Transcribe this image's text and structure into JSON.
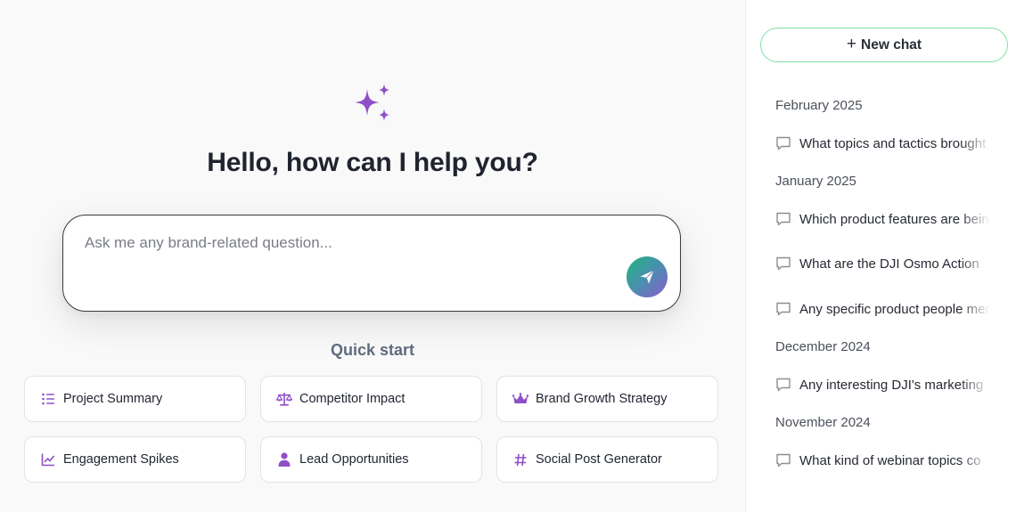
{
  "main": {
    "greeting": "Hello, how can I help you?",
    "prompt": {
      "placeholder": "Ask me any brand-related question...",
      "value": ""
    },
    "quick_start": {
      "title": "Quick start",
      "items": [
        {
          "label": "Project Summary",
          "icon": "list-icon"
        },
        {
          "label": "Competitor Impact",
          "icon": "scale-icon"
        },
        {
          "label": "Brand Growth Strategy",
          "icon": "crown-icon"
        },
        {
          "label": "Engagement Spikes",
          "icon": "chart-line-icon"
        },
        {
          "label": "Lead Opportunities",
          "icon": "person-icon"
        },
        {
          "label": "Social Post Generator",
          "icon": "hashtag-icon"
        }
      ]
    }
  },
  "sidebar": {
    "new_chat_label": "New chat",
    "groups": [
      {
        "month": "February 2025",
        "chats": [
          "What topics and tactics brought"
        ]
      },
      {
        "month": "January 2025",
        "chats": [
          "Which product features are being",
          "What are the DJI Osmo Action",
          "Any specific product people men"
        ]
      },
      {
        "month": "December 2024",
        "chats": [
          "Any interesting DJI's marketing"
        ]
      },
      {
        "month": "November 2024",
        "chats": [
          "What kind of webinar topics co"
        ]
      }
    ]
  },
  "colors": {
    "accent_purple": "#8e4fc9",
    "new_chat_border": "#7fe0a8",
    "send_gradient_start": "#1fb57e",
    "send_gradient_end": "#8e5acb"
  }
}
